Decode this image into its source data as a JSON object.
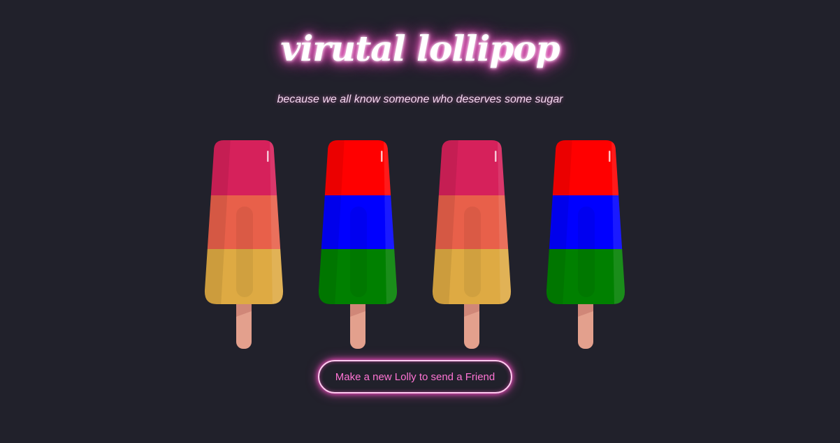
{
  "header": {
    "title": "virutal lollipop",
    "subtitle": "because we all know someone who deserves some sugar"
  },
  "lollies": [
    {
      "name": "lolly-1",
      "top_color": "#d6215b",
      "middle_color": "#e8604a",
      "bottom_color": "#deaa43"
    },
    {
      "name": "lolly-2",
      "top_color": "#ff0000",
      "middle_color": "#0000ff",
      "bottom_color": "#008000"
    },
    {
      "name": "lolly-3",
      "top_color": "#d6215b",
      "middle_color": "#e8604a",
      "bottom_color": "#deaa43"
    },
    {
      "name": "lolly-4",
      "top_color": "#ff0000",
      "middle_color": "#0000ff",
      "bottom_color": "#008000"
    }
  ],
  "stick_color": "#e3a08d",
  "cta": {
    "label": "Make a new Lolly to send a Friend"
  },
  "colors": {
    "background": "#21212b",
    "accent": "#ff74d4"
  }
}
